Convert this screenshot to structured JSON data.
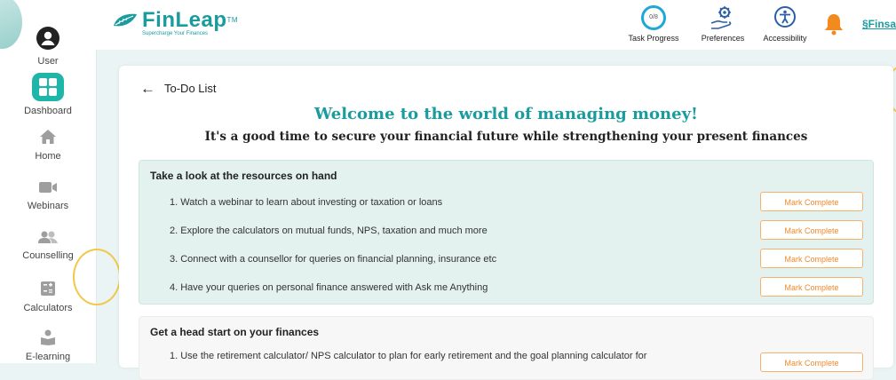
{
  "sidebar": {
    "items": [
      {
        "label": "User",
        "icon": "user-icon"
      },
      {
        "label": "Dashboard",
        "icon": "dashboard-icon"
      },
      {
        "label": "Home",
        "icon": "home-icon"
      },
      {
        "label": "Webinars",
        "icon": "video-camera-icon"
      },
      {
        "label": "Counselling",
        "icon": "people-icon"
      },
      {
        "label": "Calculators",
        "icon": "calculator-icon"
      },
      {
        "label": "E-learning",
        "icon": "learner-icon"
      }
    ]
  },
  "header": {
    "logo_text": "FinLeap",
    "logo_tm": "TM",
    "tagline": "Supercharge Your Finances",
    "task_progress_value": "0/8",
    "task_progress_label": "Task Progress",
    "preferences_label": "Preferences",
    "accessibility_label": "Accessibility",
    "partner_text": "Finsa"
  },
  "main": {
    "back_label": "To-Do List",
    "welcome": "Welcome to the world of managing money!",
    "subtitle": "It's a good time to secure your financial future while strengthening your present finances",
    "sections": [
      {
        "title": "Take a look at the resources on hand",
        "tasks": [
          {
            "text": "1. Watch a webinar to learn about investing or taxation or loans",
            "button": "Mark Complete"
          },
          {
            "text": "2. Explore the calculators on mutual funds, NPS, taxation and much more",
            "button": "Mark Complete"
          },
          {
            "text": "3. Connect with a counsellor for queries on financial planning, insurance etc",
            "button": "Mark Complete"
          },
          {
            "text": "4. Have your queries on personal finance answered with Ask me Anything",
            "button": "Mark Complete"
          }
        ]
      },
      {
        "title": "Get a head start on your finances",
        "tasks": [
          {
            "text": "1. Use the retirement calculator/ NPS calculator to plan for early retirement and the goal planning calculator for",
            "button": "Mark Complete"
          }
        ]
      }
    ]
  },
  "colors": {
    "brand": "#1a9c9e",
    "accent_orange": "#ef8a2b",
    "progress_ring": "#1fa8d6",
    "bell": "#f28a1e"
  }
}
